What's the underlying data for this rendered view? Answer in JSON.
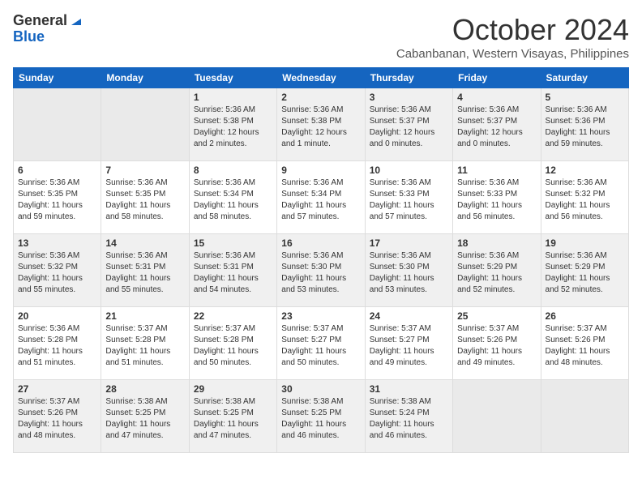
{
  "logo": {
    "general": "General",
    "blue": "Blue"
  },
  "title": {
    "month": "October 2024",
    "location": "Cabanbanan, Western Visayas, Philippines"
  },
  "headers": [
    "Sunday",
    "Monday",
    "Tuesday",
    "Wednesday",
    "Thursday",
    "Friday",
    "Saturday"
  ],
  "weeks": [
    [
      {
        "day": "",
        "info": ""
      },
      {
        "day": "",
        "info": ""
      },
      {
        "day": "1",
        "info": "Sunrise: 5:36 AM\nSunset: 5:38 PM\nDaylight: 12 hours\nand 2 minutes."
      },
      {
        "day": "2",
        "info": "Sunrise: 5:36 AM\nSunset: 5:38 PM\nDaylight: 12 hours\nand 1 minute."
      },
      {
        "day": "3",
        "info": "Sunrise: 5:36 AM\nSunset: 5:37 PM\nDaylight: 12 hours\nand 0 minutes."
      },
      {
        "day": "4",
        "info": "Sunrise: 5:36 AM\nSunset: 5:37 PM\nDaylight: 12 hours\nand 0 minutes."
      },
      {
        "day": "5",
        "info": "Sunrise: 5:36 AM\nSunset: 5:36 PM\nDaylight: 11 hours\nand 59 minutes."
      }
    ],
    [
      {
        "day": "6",
        "info": "Sunrise: 5:36 AM\nSunset: 5:35 PM\nDaylight: 11 hours\nand 59 minutes."
      },
      {
        "day": "7",
        "info": "Sunrise: 5:36 AM\nSunset: 5:35 PM\nDaylight: 11 hours\nand 58 minutes."
      },
      {
        "day": "8",
        "info": "Sunrise: 5:36 AM\nSunset: 5:34 PM\nDaylight: 11 hours\nand 58 minutes."
      },
      {
        "day": "9",
        "info": "Sunrise: 5:36 AM\nSunset: 5:34 PM\nDaylight: 11 hours\nand 57 minutes."
      },
      {
        "day": "10",
        "info": "Sunrise: 5:36 AM\nSunset: 5:33 PM\nDaylight: 11 hours\nand 57 minutes."
      },
      {
        "day": "11",
        "info": "Sunrise: 5:36 AM\nSunset: 5:33 PM\nDaylight: 11 hours\nand 56 minutes."
      },
      {
        "day": "12",
        "info": "Sunrise: 5:36 AM\nSunset: 5:32 PM\nDaylight: 11 hours\nand 56 minutes."
      }
    ],
    [
      {
        "day": "13",
        "info": "Sunrise: 5:36 AM\nSunset: 5:32 PM\nDaylight: 11 hours\nand 55 minutes."
      },
      {
        "day": "14",
        "info": "Sunrise: 5:36 AM\nSunset: 5:31 PM\nDaylight: 11 hours\nand 55 minutes."
      },
      {
        "day": "15",
        "info": "Sunrise: 5:36 AM\nSunset: 5:31 PM\nDaylight: 11 hours\nand 54 minutes."
      },
      {
        "day": "16",
        "info": "Sunrise: 5:36 AM\nSunset: 5:30 PM\nDaylight: 11 hours\nand 53 minutes."
      },
      {
        "day": "17",
        "info": "Sunrise: 5:36 AM\nSunset: 5:30 PM\nDaylight: 11 hours\nand 53 minutes."
      },
      {
        "day": "18",
        "info": "Sunrise: 5:36 AM\nSunset: 5:29 PM\nDaylight: 11 hours\nand 52 minutes."
      },
      {
        "day": "19",
        "info": "Sunrise: 5:36 AM\nSunset: 5:29 PM\nDaylight: 11 hours\nand 52 minutes."
      }
    ],
    [
      {
        "day": "20",
        "info": "Sunrise: 5:36 AM\nSunset: 5:28 PM\nDaylight: 11 hours\nand 51 minutes."
      },
      {
        "day": "21",
        "info": "Sunrise: 5:37 AM\nSunset: 5:28 PM\nDaylight: 11 hours\nand 51 minutes."
      },
      {
        "day": "22",
        "info": "Sunrise: 5:37 AM\nSunset: 5:28 PM\nDaylight: 11 hours\nand 50 minutes."
      },
      {
        "day": "23",
        "info": "Sunrise: 5:37 AM\nSunset: 5:27 PM\nDaylight: 11 hours\nand 50 minutes."
      },
      {
        "day": "24",
        "info": "Sunrise: 5:37 AM\nSunset: 5:27 PM\nDaylight: 11 hours\nand 49 minutes."
      },
      {
        "day": "25",
        "info": "Sunrise: 5:37 AM\nSunset: 5:26 PM\nDaylight: 11 hours\nand 49 minutes."
      },
      {
        "day": "26",
        "info": "Sunrise: 5:37 AM\nSunset: 5:26 PM\nDaylight: 11 hours\nand 48 minutes."
      }
    ],
    [
      {
        "day": "27",
        "info": "Sunrise: 5:37 AM\nSunset: 5:26 PM\nDaylight: 11 hours\nand 48 minutes."
      },
      {
        "day": "28",
        "info": "Sunrise: 5:38 AM\nSunset: 5:25 PM\nDaylight: 11 hours\nand 47 minutes."
      },
      {
        "day": "29",
        "info": "Sunrise: 5:38 AM\nSunset: 5:25 PM\nDaylight: 11 hours\nand 47 minutes."
      },
      {
        "day": "30",
        "info": "Sunrise: 5:38 AM\nSunset: 5:25 PM\nDaylight: 11 hours\nand 46 minutes."
      },
      {
        "day": "31",
        "info": "Sunrise: 5:38 AM\nSunset: 5:24 PM\nDaylight: 11 hours\nand 46 minutes."
      },
      {
        "day": "",
        "info": ""
      },
      {
        "day": "",
        "info": ""
      }
    ]
  ]
}
